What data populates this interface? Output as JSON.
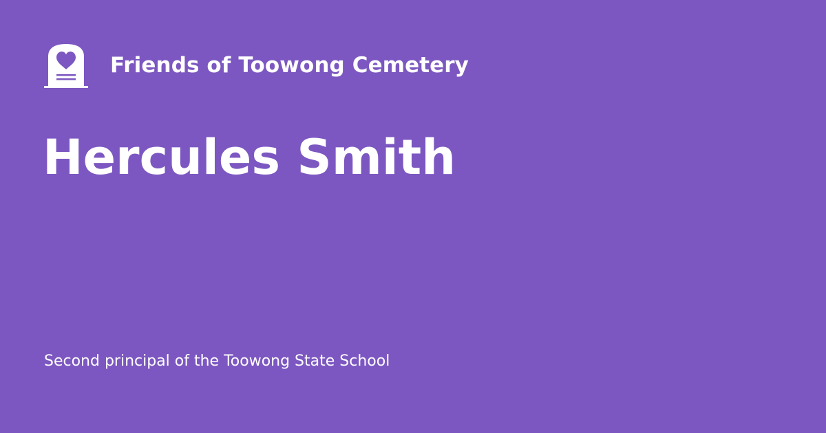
{
  "site": {
    "name": "Friends of Toowong Cemetery",
    "logo_icon": "headstone-heart-icon"
  },
  "page": {
    "title": "Hercules Smith",
    "description": "Second principal of the Toowong State School"
  },
  "colors": {
    "background": "#7c57c1",
    "text": "#ffffff"
  }
}
